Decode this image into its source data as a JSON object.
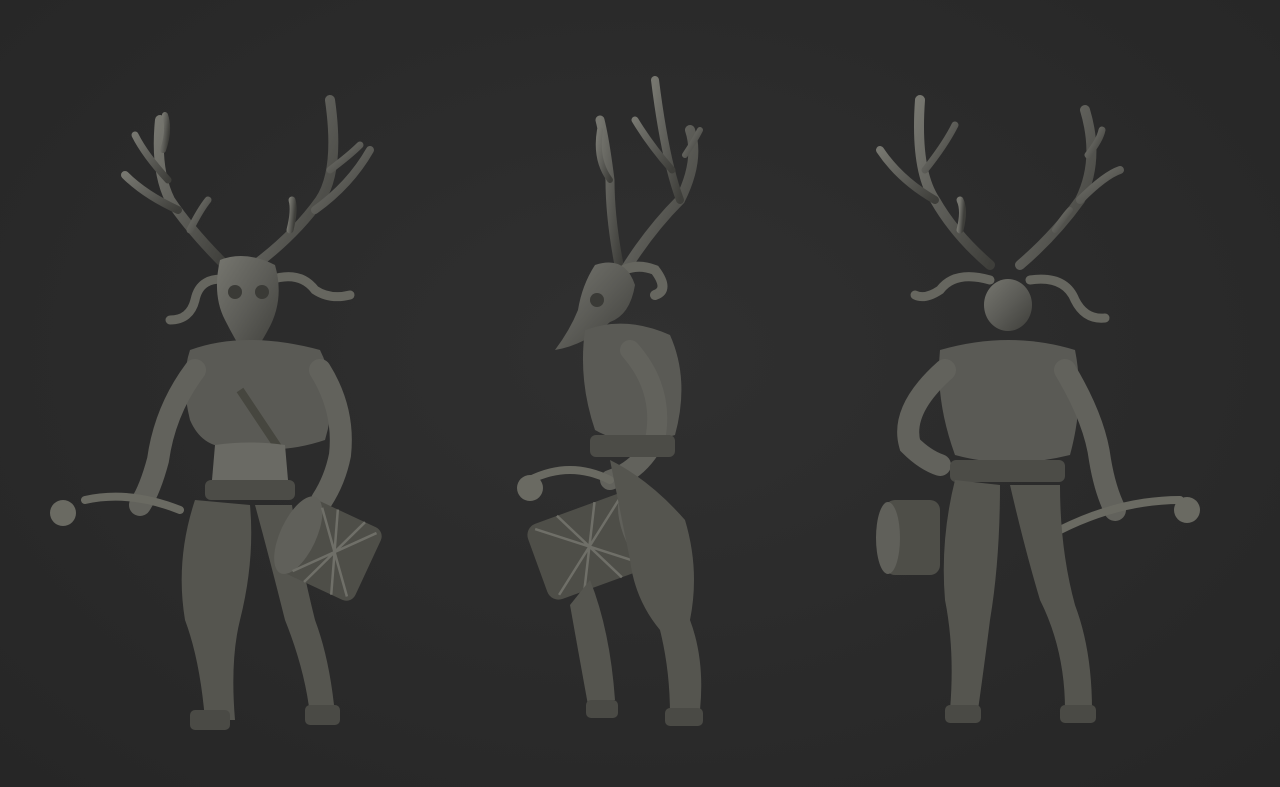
{
  "scene": {
    "background_color": "#2b2b2b",
    "figure_color": "#5a5a56",
    "figure_highlight": "#7a7a74",
    "figure_shadow": "#3c3c38"
  },
  "views": [
    {
      "id": "front",
      "icon": "satyr-sculpt-front"
    },
    {
      "id": "side",
      "icon": "satyr-sculpt-side"
    },
    {
      "id": "back",
      "icon": "satyr-sculpt-back"
    }
  ]
}
